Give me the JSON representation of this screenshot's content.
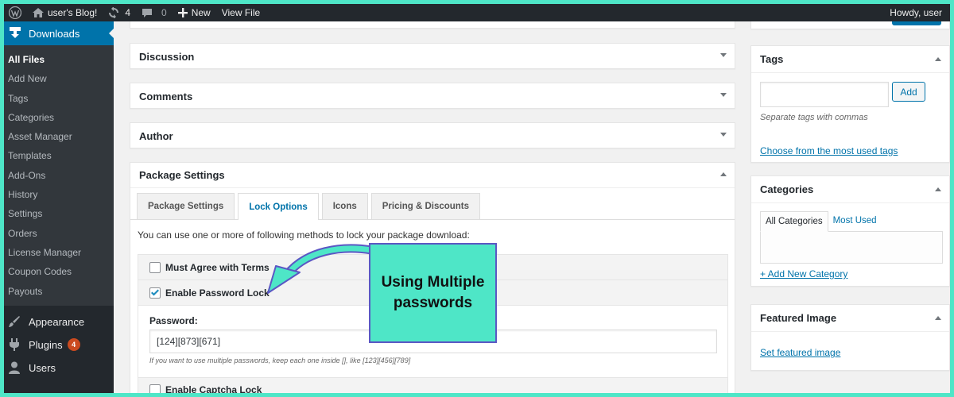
{
  "adminbar": {
    "site_name": "user's Blog!",
    "updates_count": "4",
    "comments_count": "0",
    "new_label": "New",
    "view_file_label": "View File",
    "howdy": "Howdy, user"
  },
  "sidebar": {
    "top_label": "Downloads",
    "submenu": [
      "All Files",
      "Add New",
      "Tags",
      "Categories",
      "Asset Manager",
      "Templates",
      "Add-Ons",
      "History",
      "Settings",
      "Orders",
      "License Manager",
      "Coupon Codes",
      "Payouts"
    ],
    "appearance": "Appearance",
    "plugins": "Plugins",
    "plugins_badge": "4",
    "users": "Users"
  },
  "boxes": {
    "discussion": "Discussion",
    "comments": "Comments",
    "author": "Author",
    "package_settings": "Package Settings"
  },
  "package": {
    "tabs": [
      "Package Settings",
      "Lock Options",
      "Icons",
      "Pricing & Discounts"
    ],
    "description": "You can use one or more of following methods to lock your package download:",
    "must_agree": "Must Agree with Terms",
    "enable_password": "Enable Password Lock",
    "password_label": "Password:",
    "password_value": "[124][873][671]",
    "password_hint": "If you want to use multiple passwords, keep each one inside [], like [123][456][789]",
    "enable_captcha": "Enable Captcha Lock"
  },
  "tags": {
    "title": "Tags",
    "add_button": "Add",
    "hint": "Separate tags with commas",
    "choose_link": "Choose from the most used tags"
  },
  "categories": {
    "title": "Categories",
    "tab_all": "All Categories",
    "tab_most": "Most Used",
    "add_link": "+ Add New Category"
  },
  "featured": {
    "title": "Featured Image",
    "set_link": "Set featured image"
  },
  "annotation": {
    "text": "Using Multiple passwords"
  },
  "colors": {
    "accent": "#0073aa",
    "admin_dark": "#23282d",
    "callout_bg": "#4ee6c7",
    "callout_border": "#5b57c4",
    "badge": "#ca4a1f"
  }
}
